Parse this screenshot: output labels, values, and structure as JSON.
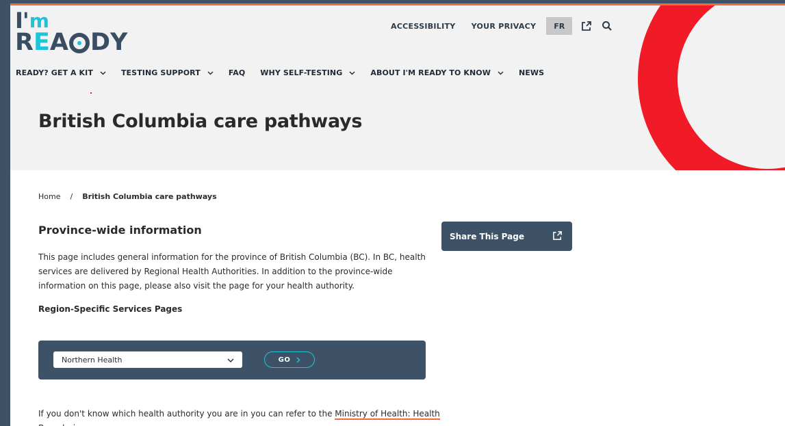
{
  "brand": {
    "logo_line1_a": "I'",
    "logo_line1_b": "m",
    "logo_r": "R",
    "logo_e": "E",
    "logo_a": "A",
    "logo_d": "D",
    "logo_y": "Y"
  },
  "utility_nav": {
    "accessibility": "ACCESSIBILITY",
    "privacy": "YOUR PRIVACY",
    "language": "FR"
  },
  "main_nav": {
    "items": [
      {
        "label": "READY? GET A KIT",
        "dropdown": true
      },
      {
        "label": "TESTING SUPPORT",
        "dropdown": true
      },
      {
        "label": "FAQ",
        "dropdown": false
      },
      {
        "label": "WHY SELF-TESTING",
        "dropdown": true
      },
      {
        "label": "ABOUT I'M READY TO KNOW",
        "dropdown": true
      },
      {
        "label": "NEWS",
        "dropdown": false
      }
    ]
  },
  "page": {
    "title": "British Columbia care pathways"
  },
  "breadcrumb": {
    "home": "Home",
    "separator": "/",
    "current": "British Columbia care pathways"
  },
  "content": {
    "heading": "Province-wide information",
    "paragraph": "This page includes general information for the province of British Columbia (BC). In BC, health services are delivered by Regional Health Authorities. In addition to the province-wide information on this page, please also visit the page for your health authority.",
    "subheading": "Region-Specific Services Pages",
    "region_select": {
      "selected": "Northern Health"
    },
    "go_label": "GO",
    "footnote_prefix": "If you don't know which health authority you are in you can refer to the ",
    "footnote_link": "Ministry of Health: Health Boundaries map"
  },
  "sidebar": {
    "share_label": "Share This Page"
  },
  "colors": {
    "accent_red": "#f01b26",
    "accent_cyan": "#1fc3d9",
    "navy": "#3d5266",
    "link_underline": "#f26a3a"
  },
  "icons": {
    "external": "external-link-icon",
    "search": "search-icon",
    "chevron": "chevron-down-icon",
    "go_chevron": "chevron-right-icon",
    "share": "share-icon"
  }
}
